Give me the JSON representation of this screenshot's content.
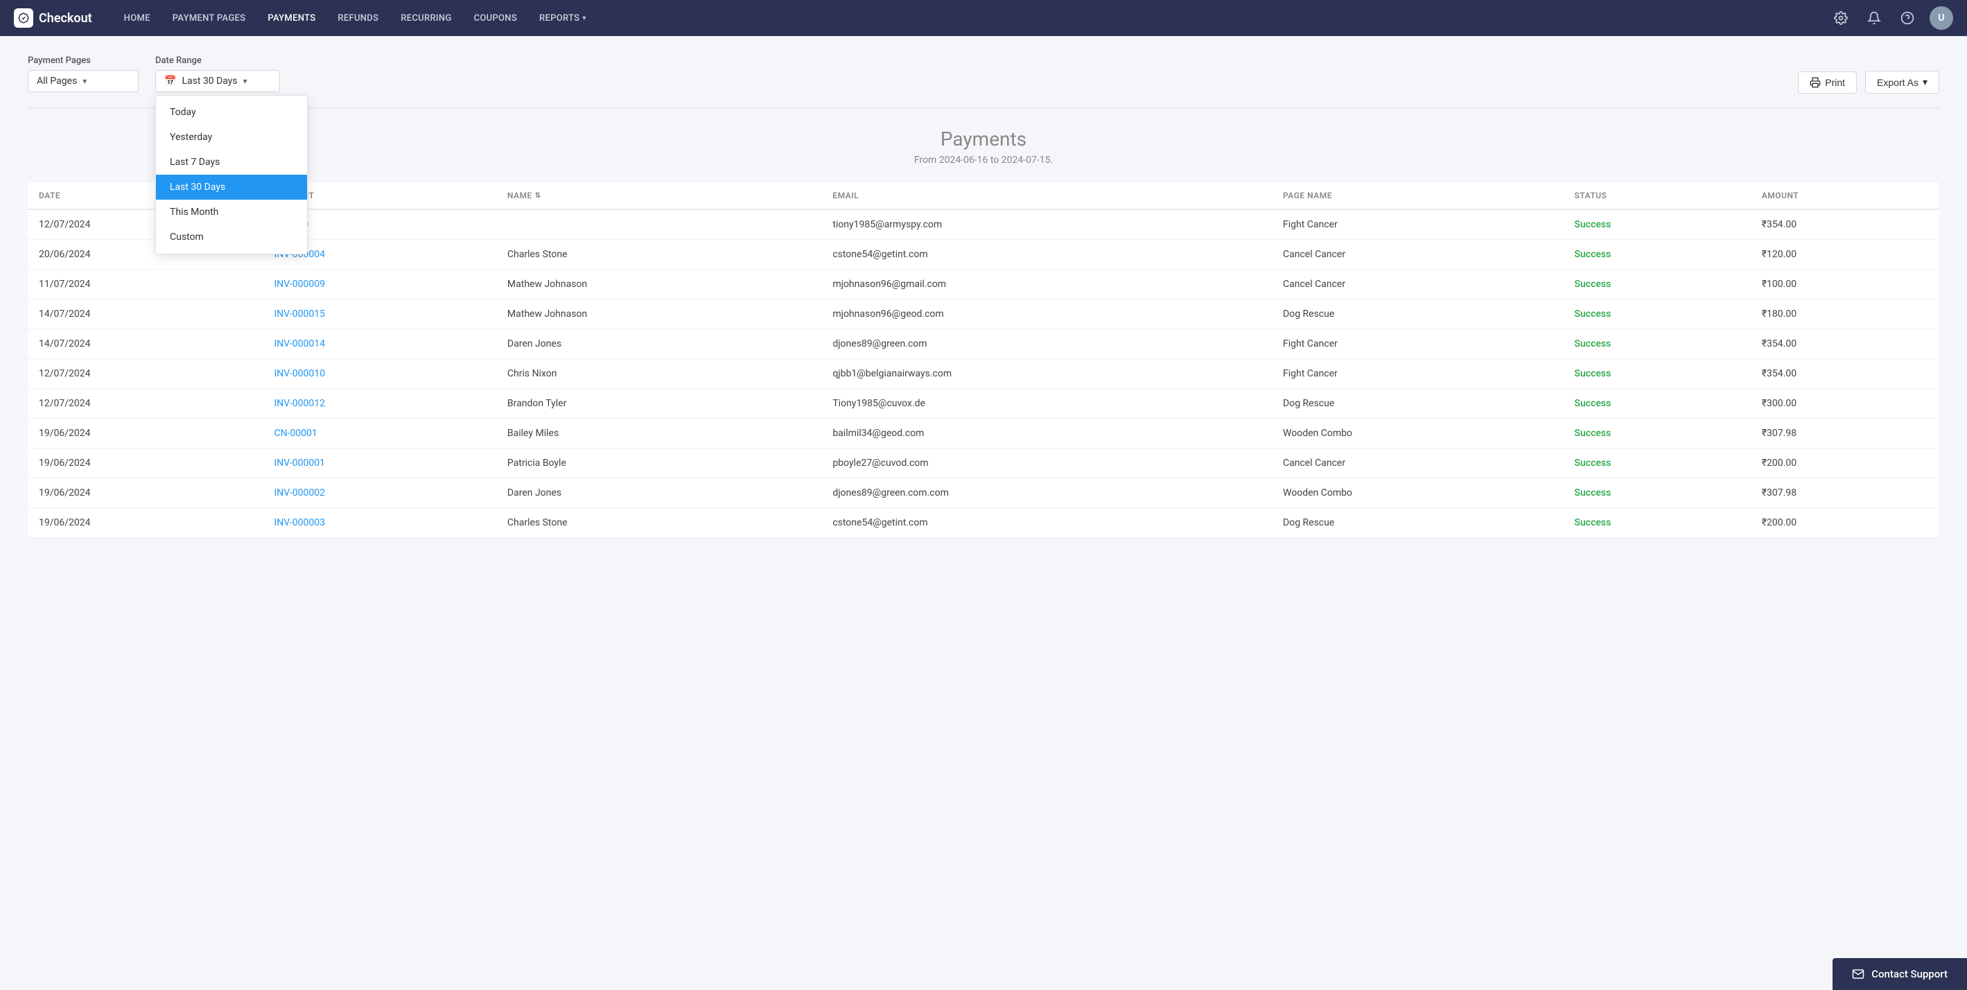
{
  "brand": {
    "name": "Checkout"
  },
  "nav": {
    "links": [
      {
        "id": "home",
        "label": "HOME"
      },
      {
        "id": "payment-pages",
        "label": "PAYMENT PAGES"
      },
      {
        "id": "payments",
        "label": "PAYMENTS"
      },
      {
        "id": "refunds",
        "label": "REFUNDS"
      },
      {
        "id": "recurring",
        "label": "RECURRING"
      },
      {
        "id": "coupons",
        "label": "COUPONS"
      },
      {
        "id": "reports",
        "label": "REPORTS",
        "hasDropdown": true
      }
    ]
  },
  "filters": {
    "payment_pages_label": "Payment Pages",
    "payment_pages_value": "All Pages",
    "date_range_label": "Date Range",
    "date_range_value": "Last 30 Days",
    "print_label": "Print",
    "export_label": "Export As"
  },
  "dropdown": {
    "options": [
      {
        "id": "today",
        "label": "Today",
        "selected": false
      },
      {
        "id": "yesterday",
        "label": "Yesterday",
        "selected": false
      },
      {
        "id": "last7days",
        "label": "Last 7 Days",
        "selected": false
      },
      {
        "id": "last30days",
        "label": "Last 30 Days",
        "selected": true
      },
      {
        "id": "thismonth",
        "label": "This Month",
        "selected": false
      },
      {
        "id": "custom",
        "label": "Custom",
        "selected": false
      }
    ]
  },
  "payments": {
    "title": "Payments",
    "subtitle": "From 2024-06-16 to 2024-07-15.",
    "columns": [
      {
        "id": "date",
        "label": "DATE"
      },
      {
        "id": "payment",
        "label": "PAYMENT"
      },
      {
        "id": "name",
        "label": "NAME",
        "sortable": true
      },
      {
        "id": "email",
        "label": "EMAIL"
      },
      {
        "id": "page_name",
        "label": "PAGE NAME"
      },
      {
        "id": "status",
        "label": "STATUS"
      },
      {
        "id": "amount",
        "label": "AMOUNT"
      }
    ],
    "rows": [
      {
        "date": "12/07/2024",
        "payment": "INV-000",
        "name": "",
        "email": "tiony1985@armyspy.com",
        "page_name": "Fight Cancer",
        "status": "Success",
        "amount": "₹354.00"
      },
      {
        "date": "20/06/2024",
        "payment": "INV-000004",
        "name": "Charles Stone",
        "email": "cstone54@getint.com",
        "page_name": "Cancel Cancer",
        "status": "Success",
        "amount": "₹120.00"
      },
      {
        "date": "11/07/2024",
        "payment": "INV-000009",
        "name": "Mathew Johnason",
        "email": "mjohnason96@gmail.com",
        "page_name": "Cancel Cancer",
        "status": "Success",
        "amount": "₹100.00"
      },
      {
        "date": "14/07/2024",
        "payment": "INV-000015",
        "name": "Mathew Johnason",
        "email": "mjohnason96@geod.com",
        "page_name": "Dog Rescue",
        "status": "Success",
        "amount": "₹180.00"
      },
      {
        "date": "14/07/2024",
        "payment": "INV-000014",
        "name": "Daren Jones",
        "email": "djones89@green.com",
        "page_name": "Fight Cancer",
        "status": "Success",
        "amount": "₹354.00"
      },
      {
        "date": "12/07/2024",
        "payment": "INV-000010",
        "name": "Chris Nixon",
        "email": "qjbb1@belgianairways.com",
        "page_name": "Fight Cancer",
        "status": "Success",
        "amount": "₹354.00"
      },
      {
        "date": "12/07/2024",
        "payment": "INV-000012",
        "name": "Brandon Tyler",
        "email": "Tiony1985@cuvox.de",
        "page_name": "Dog Rescue",
        "status": "Success",
        "amount": "₹300.00"
      },
      {
        "date": "19/06/2024",
        "payment": "CN-00001",
        "name": "Bailey Miles",
        "email": "bailmil34@geod.com",
        "page_name": "Wooden Combo",
        "status": "Success",
        "amount": "₹307.98"
      },
      {
        "date": "19/06/2024",
        "payment": "INV-000001",
        "name": "Patricia Boyle",
        "email": "pboyle27@cuvod.com",
        "page_name": "Cancel Cancer",
        "status": "Success",
        "amount": "₹200.00"
      },
      {
        "date": "19/06/2024",
        "payment": "INV-000002",
        "name": "Daren Jones",
        "email": "djones89@green.com.com",
        "page_name": "Wooden Combo",
        "status": "Success",
        "amount": "₹307.98"
      },
      {
        "date": "19/06/2024",
        "payment": "INV-000003",
        "name": "Charles Stone",
        "email": "cstone54@getint.com",
        "page_name": "Dog Rescue",
        "status": "Success",
        "amount": "₹200.00"
      }
    ]
  },
  "contact_support": {
    "label": "Contact Support"
  }
}
